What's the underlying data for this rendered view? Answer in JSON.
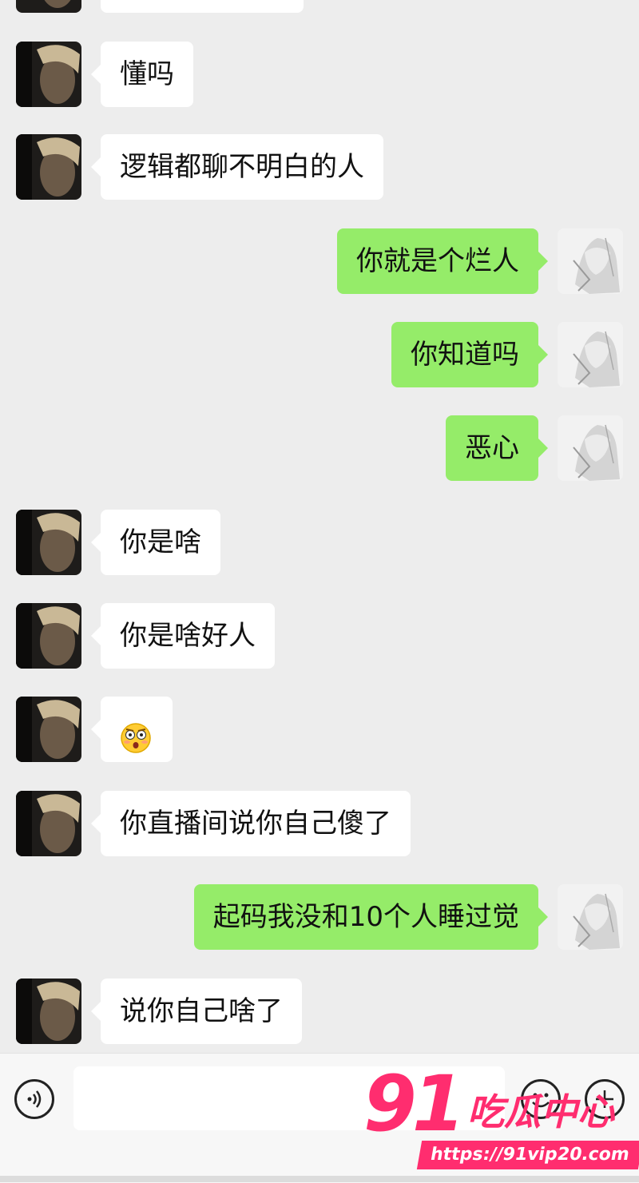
{
  "chat": {
    "messages": [
      {
        "side": "in",
        "text": "懂吗"
      },
      {
        "side": "in",
        "text": "逻辑都聊不明白的人"
      },
      {
        "side": "out",
        "text": "你就是个烂人"
      },
      {
        "side": "out",
        "text": "你知道吗"
      },
      {
        "side": "out",
        "text": "恶心"
      },
      {
        "side": "in",
        "text": "你是啥"
      },
      {
        "side": "in",
        "text": "你是啥好人"
      },
      {
        "side": "in",
        "emoji": "flushed-face"
      },
      {
        "side": "in",
        "text": "你直播间说你自己傻了"
      },
      {
        "side": "out",
        "text": "起码我没和10个人睡过觉"
      },
      {
        "side": "in",
        "text": "说你自己啥了"
      }
    ]
  },
  "input_bar": {
    "voice_icon": "voice-icon",
    "emoji_icon": "emoji-icon",
    "add_icon": "plus-icon"
  },
  "watermark": {
    "number": "91",
    "brand": "吃瓜中心",
    "url": "https://91vip20.com"
  },
  "colors": {
    "background": "#ededed",
    "outgoing_bubble": "#95ec69",
    "incoming_bubble": "#ffffff",
    "watermark": "#ff2d6f"
  }
}
